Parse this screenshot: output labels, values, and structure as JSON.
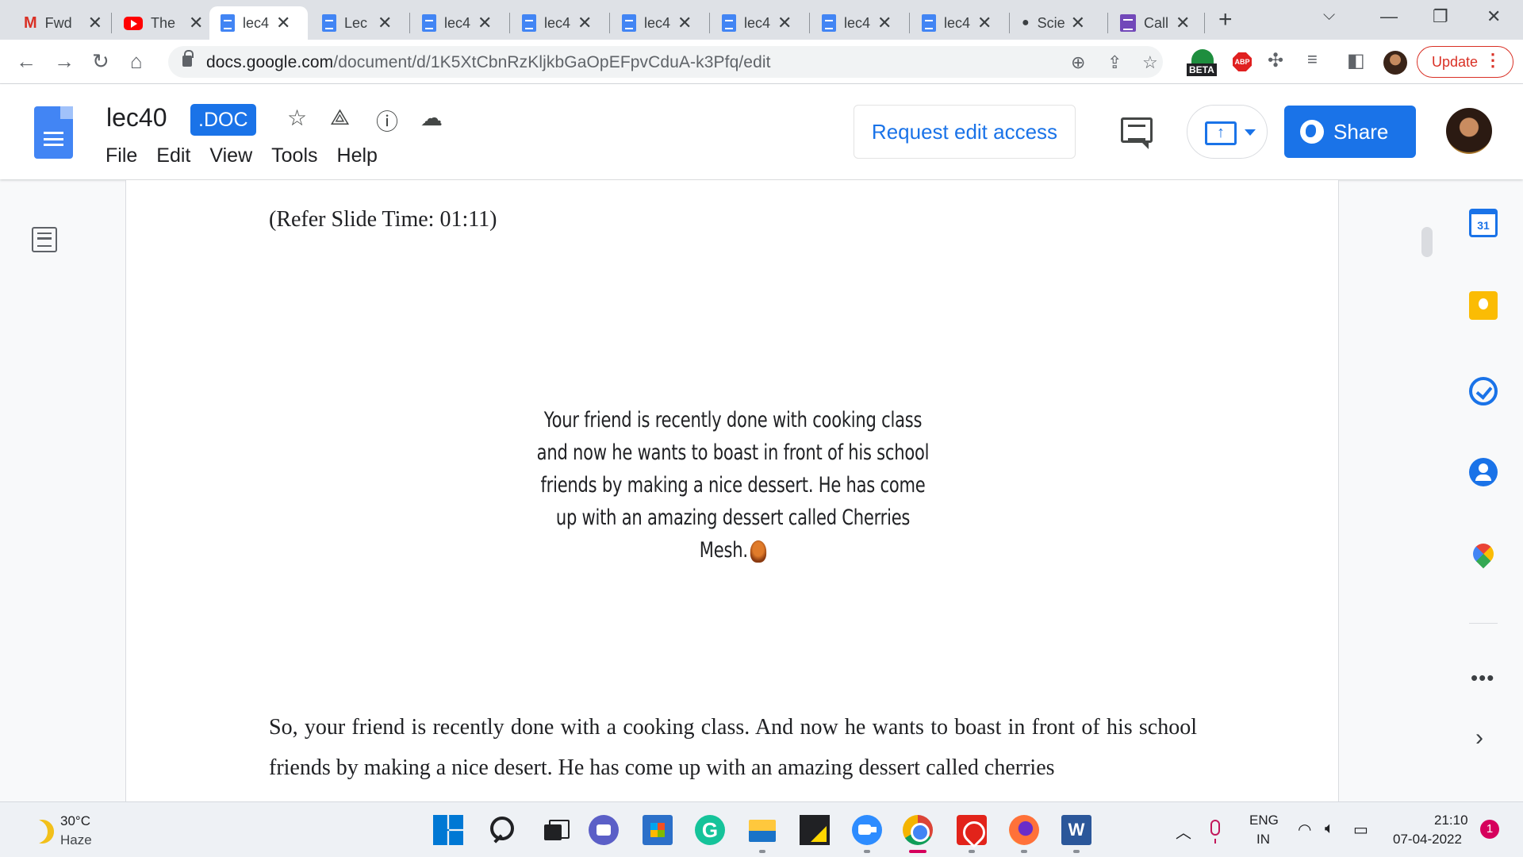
{
  "browser": {
    "tabs": [
      {
        "title": "Fwd",
        "icon": "gmail-icon"
      },
      {
        "title": "The",
        "icon": "youtube-icon"
      },
      {
        "title": "lec4",
        "icon": "docs-icon",
        "active": true
      },
      {
        "title": "Lec",
        "icon": "docs-icon"
      },
      {
        "title": "lec4",
        "icon": "docs-icon"
      },
      {
        "title": "lec4",
        "icon": "docs-icon"
      },
      {
        "title": "lec4",
        "icon": "docs-icon"
      },
      {
        "title": "lec4",
        "icon": "docs-icon"
      },
      {
        "title": "lec4",
        "icon": "docs-icon"
      },
      {
        "title": "lec4",
        "icon": "docs-icon"
      },
      {
        "title": "Scie",
        "icon": "brain-icon"
      },
      {
        "title": "Call",
        "icon": "forms-icon"
      }
    ],
    "url_domain": "docs.google.com",
    "url_path": "/document/d/1K5XtCbnRzKljkbGaOpEFpvCduA-k3Pfq/edit",
    "beta_label": "BETA",
    "abp_label": "ABP",
    "update_label": "Update"
  },
  "docs": {
    "title": "lec40",
    "badge": ".DOC",
    "menu": [
      "File",
      "Edit",
      "View",
      "Tools",
      "Help"
    ],
    "request_edit_label": "Request edit access",
    "share_label": "Share"
  },
  "document": {
    "slide_time": "(Refer Slide Time: 01:11)",
    "slide_text": "Your friend is recently done with cooking class and now he wants to boast in front of his school friends by making a nice dessert. He has come up with an amazing dessert called Cherries Mesh.",
    "body_text": "So, your friend is recently done with a cooking class. And now he wants to boast in front of his school friends by making a nice desert. He has come up with an amazing dessert called cherries"
  },
  "side_panel": {
    "calendar_day": "31"
  },
  "taskbar": {
    "temperature": "30°C",
    "weather": "Haze",
    "lang_primary": "ENG",
    "lang_region": "IN",
    "time": "21:10",
    "date": "07-04-2022",
    "notification_count": "1"
  },
  "colors": {
    "accent": "#1a73e8",
    "danger": "#d93025"
  }
}
